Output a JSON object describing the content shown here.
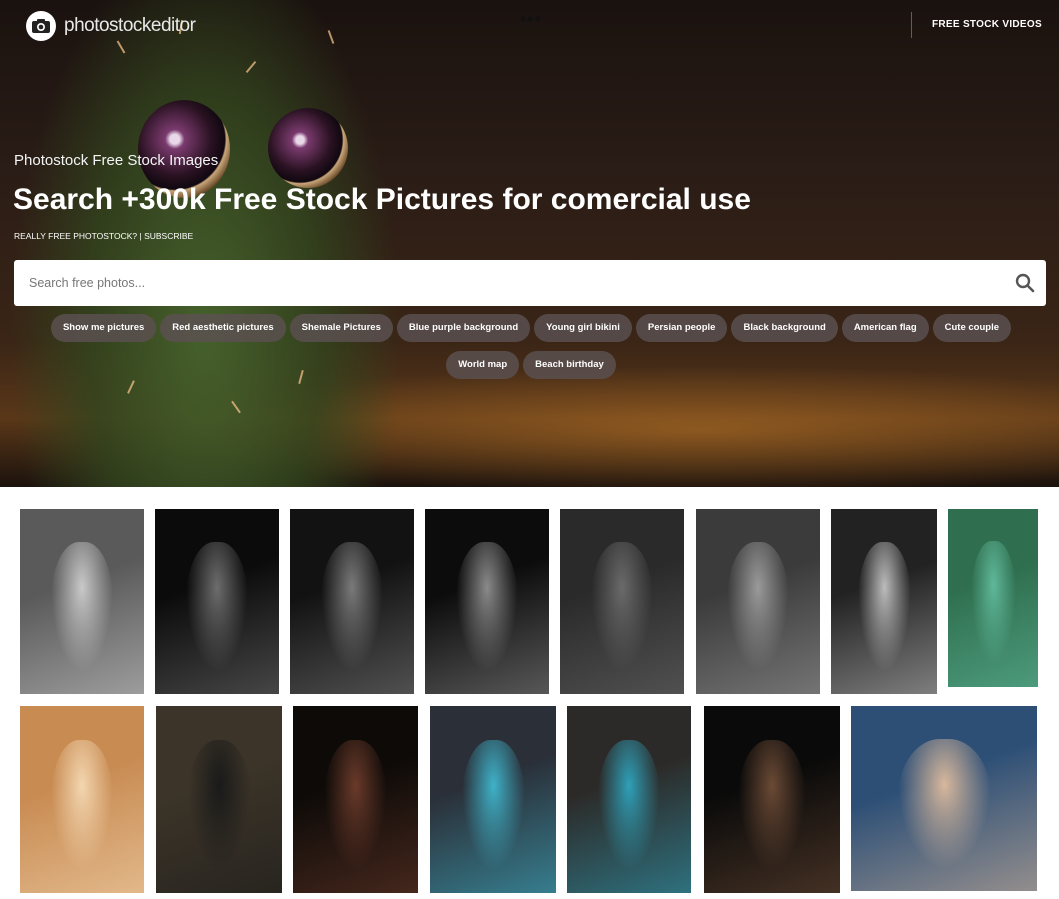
{
  "header": {
    "logo_text": "photostockeditor",
    "more_label": "•••",
    "nav_videos_label": "FREE STOCK VIDEOS"
  },
  "hero": {
    "subtitle": "Photostock Free Stock Images",
    "headline": "Search +300k Free Stock Pictures for comercial use",
    "promo": "REALLY FREE PHOTOSTOCK? | SUBSCRIBE",
    "search": {
      "placeholder": "Search free photos...",
      "value": ""
    },
    "chips": [
      "Show me pictures",
      "Red aesthetic pictures",
      "Shemale Pictures",
      "Blue purple background",
      "Young girl bikini",
      "Persian people",
      "Black background",
      "American flag",
      "Cute couple",
      "World map",
      "Beach birthday"
    ]
  },
  "gallery": {
    "rows": [
      [
        {
          "desc": "woman-portrait-bw"
        },
        {
          "desc": "nude-back-bw"
        },
        {
          "desc": "woman-face-dark"
        },
        {
          "desc": "back-lace-bw"
        },
        {
          "desc": "woman-profile-bw"
        },
        {
          "desc": "woman-beach-bw"
        },
        {
          "desc": "woman-closeup-bw"
        },
        {
          "desc": "aerial-coastline"
        }
      ],
      [
        {
          "desc": "woman-warm-light"
        },
        {
          "desc": "skull-makeup-forest"
        },
        {
          "desc": "woman-red-lips-dark"
        },
        {
          "desc": "skull-figure-blue-smoke"
        },
        {
          "desc": "skull-hood-blue-smoke"
        },
        {
          "desc": "woman-dark-skin-portrait"
        },
        {
          "desc": "woman-blonde-portrait"
        }
      ]
    ]
  },
  "colors": {
    "chip_bg": "#5a5050",
    "hero_text": "#ffffff",
    "page_bg": "#ffffff"
  }
}
